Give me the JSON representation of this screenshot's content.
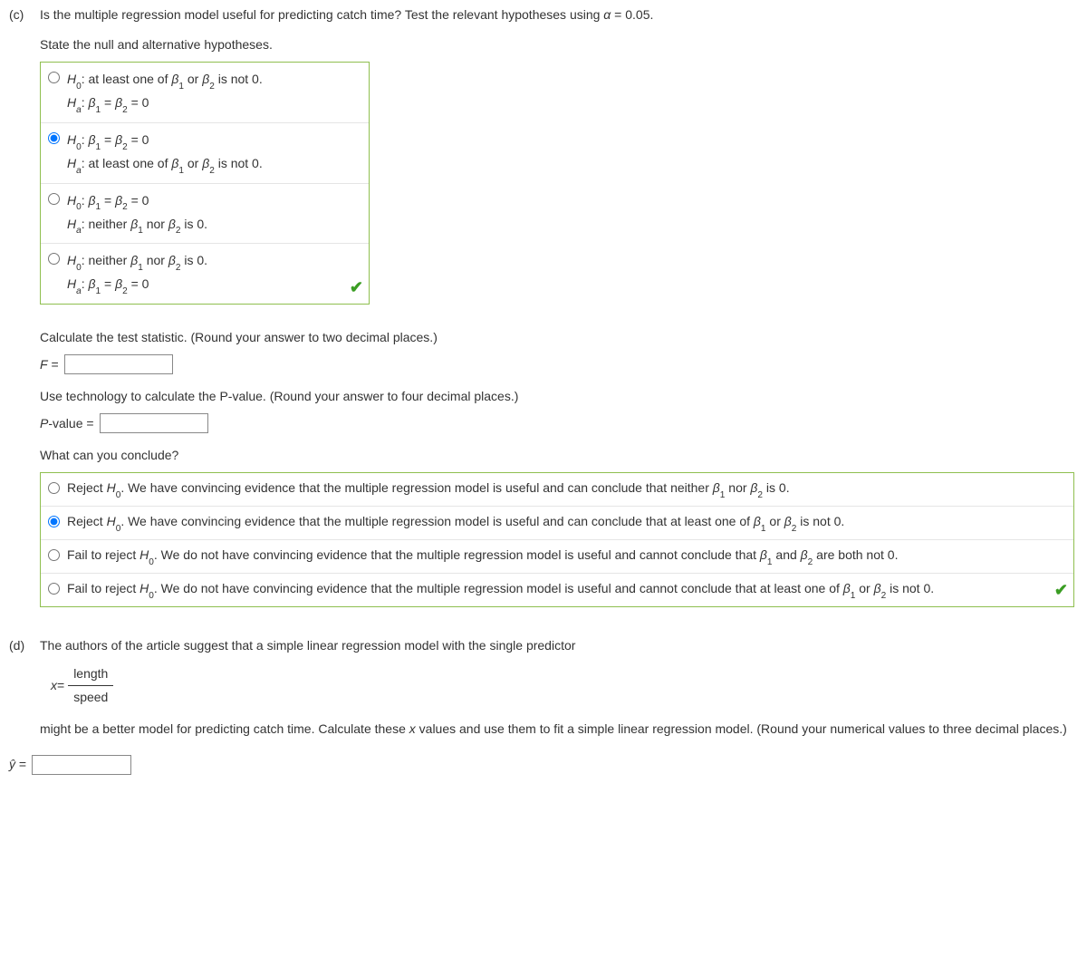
{
  "partC": {
    "label": "(c)",
    "prompt": "Is the multiple regression model useful for predicting catch time? Test the relevant hypotheses using α = 0.05.",
    "state_prompt": "State the null and alternative hypotheses.",
    "hyp_options": [
      {
        "h0_pre": "H",
        "h0_sub": "0",
        "h0_txt": ": at least one of ",
        "h0_b1": "β",
        "h0_b1s": "1",
        "h0_mid": " or ",
        "h0_b2": "β",
        "h0_b2s": "2",
        "h0_post": " is not 0.",
        "ha_pre": "H",
        "ha_sub": "a",
        "ha_txt": ": ",
        "ha_b1": "β",
        "ha_b1s": "1",
        "ha_eq": " = ",
        "ha_b2": "β",
        "ha_b2s": "2",
        "ha_post": " = 0"
      },
      {
        "h0_pre": "H",
        "h0_sub": "0",
        "h0_txt": ": ",
        "h0_b1": "β",
        "h0_b1s": "1",
        "h0_eq": " = ",
        "h0_b2": "β",
        "h0_b2s": "2",
        "h0_post": " = 0",
        "ha_pre": "H",
        "ha_sub": "a",
        "ha_txt": ": at least one of ",
        "ha_b1": "β",
        "ha_b1s": "1",
        "ha_mid": " or ",
        "ha_b2": "β",
        "ha_b2s": "2",
        "ha_post": " is not 0."
      },
      {
        "h0_pre": "H",
        "h0_sub": "0",
        "h0_txt": ": ",
        "h0_b1": "β",
        "h0_b1s": "1",
        "h0_eq": " = ",
        "h0_b2": "β",
        "h0_b2s": "2",
        "h0_post": " = 0",
        "ha_pre": "H",
        "ha_sub": "a",
        "ha_txt": ": neither ",
        "ha_b1": "β",
        "ha_b1s": "1",
        "ha_mid": " nor ",
        "ha_b2": "β",
        "ha_b2s": "2",
        "ha_post": " is 0."
      },
      {
        "h0_pre": "H",
        "h0_sub": "0",
        "h0_txt": ": neither ",
        "h0_b1": "β",
        "h0_b1s": "1",
        "h0_mid": " nor ",
        "h0_b2": "β",
        "h0_b2s": "2",
        "h0_post": " is 0.",
        "ha_pre": "H",
        "ha_sub": "a",
        "ha_txt": ": ",
        "ha_b1": "β",
        "ha_b1s": "1",
        "ha_eq": " = ",
        "ha_b2": "β",
        "ha_b2s": "2",
        "ha_post": " = 0"
      }
    ],
    "calc_stat_prompt": "Calculate the test statistic. (Round your answer to two decimal places.)",
    "f_label_var": "F",
    "f_label_eq": " = ",
    "pval_prompt": "Use technology to calculate the P-value. (Round your answer to four decimal places.)",
    "pval_label_var": "P",
    "pval_label_rest": "-value = ",
    "conclude_prompt": "What can you conclude?",
    "conc_options": [
      {
        "pre": "Reject ",
        "h": "H",
        "hs": "0",
        "post": ". We have convincing evidence that the multiple regression model is useful and can conclude that neither ",
        "b1": "β",
        "b1s": "1",
        "mid": " nor ",
        "b2": "β",
        "b2s": "2",
        "tail": " is 0."
      },
      {
        "pre": "Reject ",
        "h": "H",
        "hs": "0",
        "post": ". We have convincing evidence that the multiple regression model is useful and can conclude that at least one of ",
        "b1": "β",
        "b1s": "1",
        "mid": " or ",
        "b2": "β",
        "b2s": "2",
        "tail": " is not 0."
      },
      {
        "pre": "Fail to reject ",
        "h": "H",
        "hs": "0",
        "post": ". We do not have convincing evidence that the multiple regression model is useful and cannot conclude that ",
        "b1": "β",
        "b1s": "1",
        "mid": " and ",
        "b2": "β",
        "b2s": "2",
        "tail": " are both not 0."
      },
      {
        "pre": "Fail to reject ",
        "h": "H",
        "hs": "0",
        "post": ". We do not have convincing evidence that the multiple regression model is useful and cannot conclude that at least one of ",
        "b1": "β",
        "b1s": "1",
        "mid": " or ",
        "b2": "β",
        "b2s": "2",
        "tail": " is not 0."
      }
    ]
  },
  "partD": {
    "label": "(d)",
    "prompt": "The authors of the article suggest that a simple linear regression model with the single predictor",
    "x_var": "x",
    "x_eq": " = ",
    "frac_num": "length",
    "frac_den": "speed",
    "prompt2_a": "might be a better model for predicting catch time. Calculate these ",
    "prompt2_x": "x",
    "prompt2_b": " values and use them to fit a simple linear regression model. (Round your numerical values to three decimal places.)",
    "yhat": "ŷ",
    "yhat_eq": " = "
  }
}
